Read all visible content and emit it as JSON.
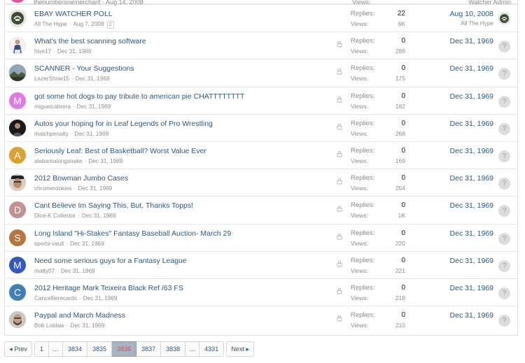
{
  "partial_row": {
    "meta": "thenumberonemerchant · Aug 14, 2008",
    "views": "Views:",
    "last_user": "Watcher Admin"
  },
  "threads": [
    {
      "title": "EBAY WATCHER POLL",
      "author": "All The Hype",
      "date": "Aug 7, 2008",
      "page_badge": "2",
      "locked": false,
      "replies_label": "Replies:",
      "views_label": "Views:",
      "replies": "22",
      "views": "6K",
      "last_date": "Aug 10, 2008",
      "last_user": "All The Hype",
      "avatar": {
        "type": "photo",
        "icon": "hype-logo-icon",
        "color": "#2f3b2c"
      },
      "last_avatar": "hype-logo-icon"
    },
    {
      "title": "What's the best scanning software",
      "author": "hive17",
      "date": "Dec 31, 1969",
      "locked": true,
      "replies_label": "Replies:",
      "views_label": "Views:",
      "replies": "0",
      "views": "289",
      "last_date": "Dec 31, 1969",
      "last_user": "",
      "avatar": {
        "type": "photo",
        "icon": "player-photo-icon",
        "color": "#3a4f8a"
      }
    },
    {
      "title": "SCANNER - Your Suggestions",
      "author": "LazerShow15",
      "date": "Dec 31, 1969",
      "locked": true,
      "replies_label": "Replies:",
      "views_label": "Views:",
      "replies": "0",
      "views": "175",
      "last_date": "Dec 31, 1969",
      "last_user": "",
      "avatar": {
        "type": "photo",
        "icon": "landscape-photo-icon",
        "color": "#4b5a3a"
      }
    },
    {
      "title": "got some hot dogs to pay tribute to american pie CHATTTTTTTT",
      "author": "miguelcabrera",
      "date": "Dec 31, 1969",
      "locked": true,
      "replies_label": "Replies:",
      "views_label": "Views:",
      "replies": "0",
      "views": "182",
      "last_date": "Dec 31, 1969",
      "last_user": "",
      "avatar": {
        "type": "letter",
        "letter": "M",
        "color": "#e07ae3"
      }
    },
    {
      "title": "Autos your hoping for in Leaf Legends of Pro Wrestling",
      "author": "matchpenalty",
      "date": "Dec 31, 1969",
      "locked": true,
      "replies_label": "Replies:",
      "views_label": "Views:",
      "replies": "0",
      "views": "268",
      "last_date": "Dec 31, 1969",
      "last_user": "",
      "avatar": {
        "type": "photo",
        "icon": "person-photo-icon",
        "color": "#222222"
      }
    },
    {
      "title": "Seriously Leaf: Best of Basketball? Worst Value Ever",
      "author": "alabamalongsnake",
      "date": "Dec 31, 1969",
      "locked": true,
      "replies_label": "Replies:",
      "views_label": "Views:",
      "replies": "0",
      "views": "169",
      "last_date": "Dec 31, 1969",
      "last_user": "",
      "avatar": {
        "type": "letter",
        "letter": "A",
        "color": "#d9a233"
      }
    },
    {
      "title": "2012 Bowman Jumbo Cases",
      "author": "chromerookies",
      "date": "Dec 31, 1969",
      "locked": true,
      "replies_label": "Replies:",
      "views_label": "Views:",
      "replies": "0",
      "views": "254",
      "last_date": "Dec 31, 1969",
      "last_user": "",
      "avatar": {
        "type": "photo",
        "icon": "face-photo-icon",
        "color": "#8a6a4a"
      }
    },
    {
      "title": "Cant Believe Im Saying This, But, Thanks Topps!",
      "author": "Dice-K Collector",
      "date": "Dec 31, 1969",
      "locked": true,
      "replies_label": "Replies:",
      "views_label": "Views:",
      "replies": "0",
      "views": "1K",
      "last_date": "Dec 31, 1969",
      "last_user": "",
      "avatar": {
        "type": "letter",
        "letter": "D",
        "color": "#c49090"
      }
    },
    {
      "title": "Long Island \"Hi-Stakes\" Fantasy Baseball Auction- March 29",
      "author": "sports-vault",
      "date": "Dec 31, 1969",
      "locked": true,
      "replies_label": "Replies:",
      "views_label": "Views:",
      "replies": "0",
      "views": "220",
      "last_date": "Dec 31, 1969",
      "last_user": "",
      "avatar": {
        "type": "letter",
        "letter": "S",
        "color": "#b5773f"
      }
    },
    {
      "title": "Need some serious guys for a Fantasy League",
      "author": "matty07",
      "date": "Dec 31, 1969",
      "locked": true,
      "replies_label": "Replies:",
      "views_label": "Views:",
      "replies": "0",
      "views": "221",
      "last_date": "Dec 31, 1969",
      "last_user": "",
      "avatar": {
        "type": "letter",
        "letter": "M",
        "color": "#3358c2"
      }
    },
    {
      "title": "2012 Heritage Mark Teixeira Black Ref /63 FS",
      "author": "Cancellierecards",
      "date": "Dec 31, 1969",
      "locked": true,
      "replies_label": "Replies:",
      "views_label": "Views:",
      "replies": "0",
      "views": "218",
      "last_date": "Dec 31, 1969",
      "last_user": "",
      "avatar": {
        "type": "letter",
        "letter": "C",
        "color": "#3f7fb8"
      }
    },
    {
      "title": "Paypal and March Madness",
      "author": "Bob Loblaw",
      "date": "Dec 31, 1969",
      "locked": true,
      "replies_label": "Replies:",
      "views_label": "Views:",
      "replies": "0",
      "views": "210",
      "last_date": "Dec 31, 1969",
      "last_user": "",
      "avatar": {
        "type": "photo",
        "icon": "bearded-face-photo-icon",
        "color": "#7c6a5a"
      }
    }
  ],
  "unknown_avatar_glyph": "?",
  "pagination": {
    "prev": "◂ Prev",
    "next": "Next ▸",
    "pages": [
      "1",
      "…",
      "3834",
      "3835",
      "3836",
      "3837",
      "3838",
      "…",
      "4331"
    ],
    "current": "3836"
  },
  "colors": {
    "link": "#2b577f",
    "muted": "#8c8c8c",
    "current_page_bg": "#a5b3c2",
    "current_page_text": "#e14e4e"
  }
}
